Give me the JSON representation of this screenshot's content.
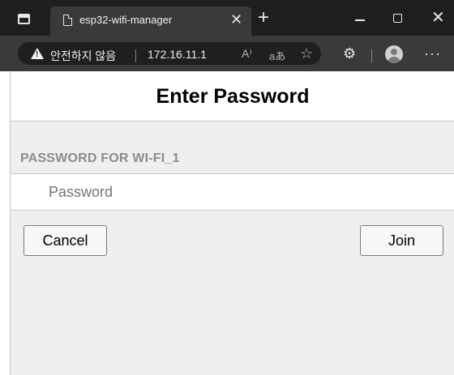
{
  "browser": {
    "tab": {
      "title": "esp32-wifi-manager",
      "close": "✕"
    },
    "new_tab": "+",
    "window": {
      "close": "✕"
    },
    "address": {
      "security_warning": "안전하지 않음",
      "url": "172.16.11.1",
      "read_aloud": "A⁾",
      "translate": "aあ",
      "favorite": "☆",
      "extensions": "⚙",
      "more": "···"
    }
  },
  "page": {
    "title": "Enter Password",
    "section_label": "PASSWORD FOR WI-FI_1",
    "password_placeholder": "Password",
    "buttons": {
      "cancel": "Cancel",
      "join": "Join"
    }
  }
}
